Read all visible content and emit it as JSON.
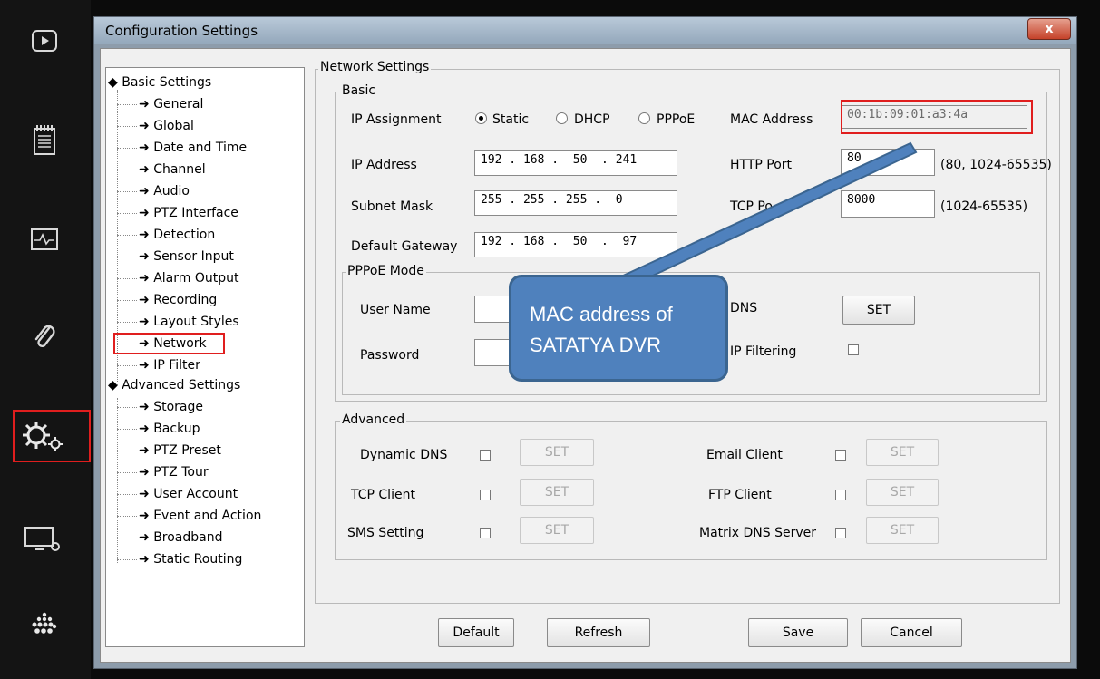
{
  "sidebar": {
    "icons": [
      "play-icon",
      "notepad-icon",
      "pulse-monitor-icon",
      "paperclip-icon",
      "gears-icon",
      "display-settings-icon",
      "dots-grid-icon"
    ]
  },
  "window": {
    "title": "Configuration Settings",
    "close_glyph": "x"
  },
  "tree": {
    "basic_header": "Basic Settings",
    "basic_items": [
      "General",
      "Global",
      "Date and Time",
      "Channel",
      "Audio",
      "PTZ Interface",
      "Detection",
      "Sensor Input",
      "Alarm Output",
      "Recording",
      "Layout Styles",
      "Network",
      "IP Filter"
    ],
    "advanced_header": "Advanced Settings",
    "advanced_items": [
      "Storage",
      "Backup",
      "PTZ Preset",
      "PTZ Tour",
      "User Account",
      "Event and Action",
      "Broadband",
      "Static Routing"
    ]
  },
  "network": {
    "group_title": "Network Settings",
    "basic": {
      "title": "Basic",
      "ip_assignment_label": "IP Assignment",
      "options": [
        "Static",
        "DHCP",
        "PPPoE"
      ],
      "selected": "Static",
      "mac_label": "MAC Address",
      "mac_value": "00:1b:09:01:a3:4a",
      "ip_address_label": "IP Address",
      "ip_address": "192 . 168 .  50  . 241",
      "subnet_label": "Subnet Mask",
      "subnet": "255 . 255 . 255 .  0",
      "gateway_label": "Default Gateway",
      "gateway": "192 . 168 .  50  .  97",
      "http_port_label": "HTTP Port",
      "http_port": "80",
      "http_range": "(80, 1024-65535)",
      "tcp_port_label": "TCP Po",
      "tcp_port": "8000",
      "tcp_range": "(1024-65535)"
    },
    "pppoe": {
      "title": "PPPoE Mode",
      "username_label": "User Name",
      "password_label": "Password",
      "dns_label": "DNS",
      "dns_button": "SET",
      "ip_filtering_label": "IP Filtering"
    },
    "advanced": {
      "title": "Advanced",
      "dynamic_dns_label": "Dynamic DNS",
      "tcp_client_label": "TCP Client",
      "sms_setting_label": "SMS Setting",
      "email_client_label": "Email Client",
      "ftp_client_label": "FTP Client",
      "matrix_dns_label": "Matrix DNS Server",
      "set_label": "SET"
    }
  },
  "buttons": {
    "default": "Default",
    "refresh": "Refresh",
    "save": "Save",
    "cancel": "Cancel"
  },
  "callout": {
    "line1": "MAC address of",
    "line2": "SATATYA DVR"
  },
  "colors": {
    "highlight": "#e01e1e",
    "callout_fill": "#4f81bd",
    "window_frame": "#8d9cab"
  }
}
